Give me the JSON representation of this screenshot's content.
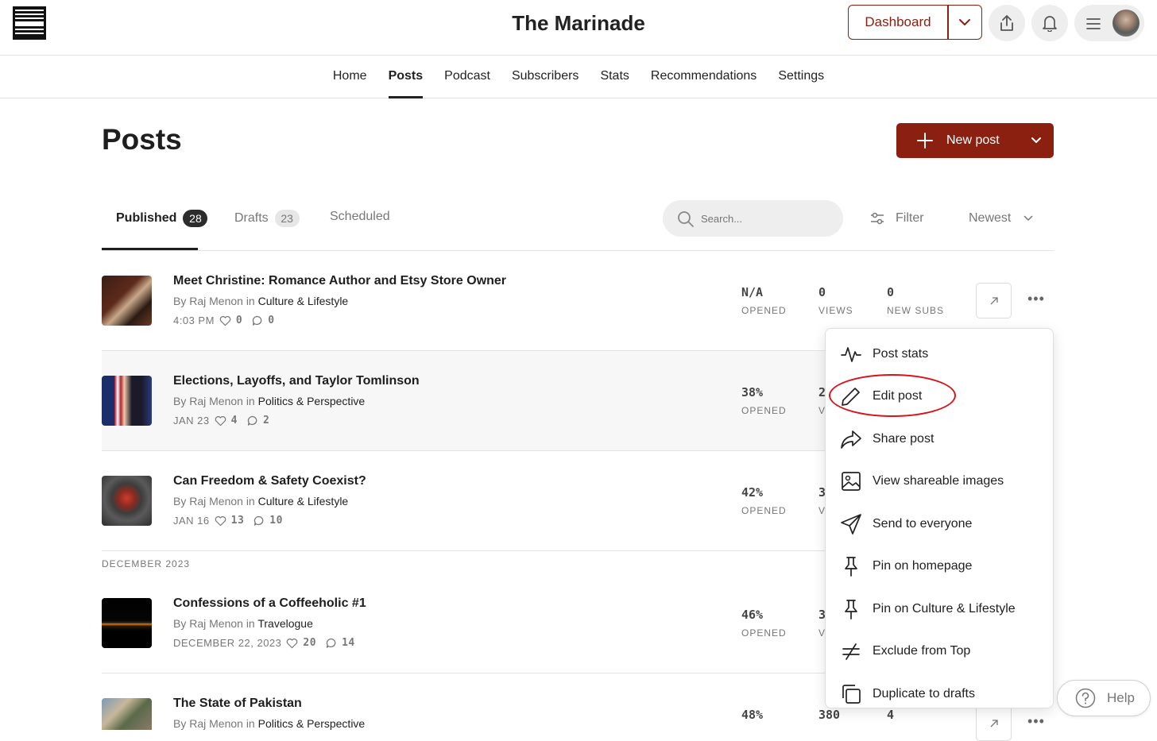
{
  "header": {
    "brand": "The Marinade",
    "dashboard_label": "Dashboard"
  },
  "nav": [
    "Home",
    "Posts",
    "Podcast",
    "Subscribers",
    "Stats",
    "Recommendations",
    "Settings"
  ],
  "page": {
    "title": "Posts",
    "new_post_label": "New post"
  },
  "tabs": [
    {
      "label": "Published",
      "count": "28"
    },
    {
      "label": "Drafts",
      "count": "23"
    },
    {
      "label": "Scheduled",
      "count": ""
    }
  ],
  "search": {
    "placeholder": "Search..."
  },
  "filter_label": "Filter",
  "sort_label": "Newest",
  "section_header": "DECEMBER 2023",
  "posts": [
    {
      "title": "Meet Christine: Romance Author and Etsy Store Owner",
      "by": "By Raj Menon in ",
      "category": "Culture & Lifestyle",
      "date": "4:03 PM",
      "likes": "0",
      "comments": "0",
      "opened": "N/A",
      "opened_label": "OPENED",
      "views": "0",
      "views_label": "VIEWS",
      "subs": "0",
      "subs_label": "NEW SUBS"
    },
    {
      "title": "Elections, Layoffs, and Taylor Tomlinson",
      "by": "By Raj Menon in ",
      "category": "Politics & Perspective",
      "date": "JAN 23",
      "likes": "4",
      "comments": "2",
      "opened": "38%",
      "opened_label": "OPENED",
      "views": "2",
      "views_label": "V"
    },
    {
      "title": "Can Freedom & Safety Coexist?",
      "by": "By Raj Menon in ",
      "category": "Culture & Lifestyle",
      "date": "JAN 16",
      "likes": "13",
      "comments": "10",
      "opened": "42%",
      "opened_label": "OPENED",
      "views": "3",
      "views_label": "V"
    },
    {
      "title": "Confessions of a Coffeeholic #1",
      "by": "By Raj Menon in ",
      "category": "Travelogue",
      "date": "DECEMBER 22, 2023",
      "likes": "20",
      "comments": "14",
      "opened": "46%",
      "opened_label": "OPENED",
      "views": "3",
      "views_label": "V"
    },
    {
      "title": "The State of Pakistan",
      "by": "By Raj Menon in ",
      "category": "Politics & Perspective",
      "opened": "48%",
      "opened_label": "OPENED",
      "views": "380",
      "views_label": "VIEWS",
      "subs": "4",
      "subs_label": "NEW SUBS"
    }
  ],
  "menu": [
    {
      "label": "Post stats",
      "icon": "activity-icon"
    },
    {
      "label": "Edit post",
      "icon": "pencil-icon"
    },
    {
      "label": "Share post",
      "icon": "share-arrow-icon"
    },
    {
      "label": "View shareable images",
      "icon": "image-icon"
    },
    {
      "label": "Send to everyone",
      "icon": "send-icon"
    },
    {
      "label": "Pin on homepage",
      "icon": "pin-icon"
    },
    {
      "label": "Pin on Culture & Lifestyle",
      "icon": "pin-icon"
    },
    {
      "label": "Exclude from Top",
      "icon": "not-equal-icon"
    },
    {
      "label": "Duplicate to drafts",
      "icon": "duplicate-icon"
    }
  ],
  "help_label": "Help",
  "colors": {
    "brand": "#8b2010",
    "annotation": "#d6141c"
  }
}
